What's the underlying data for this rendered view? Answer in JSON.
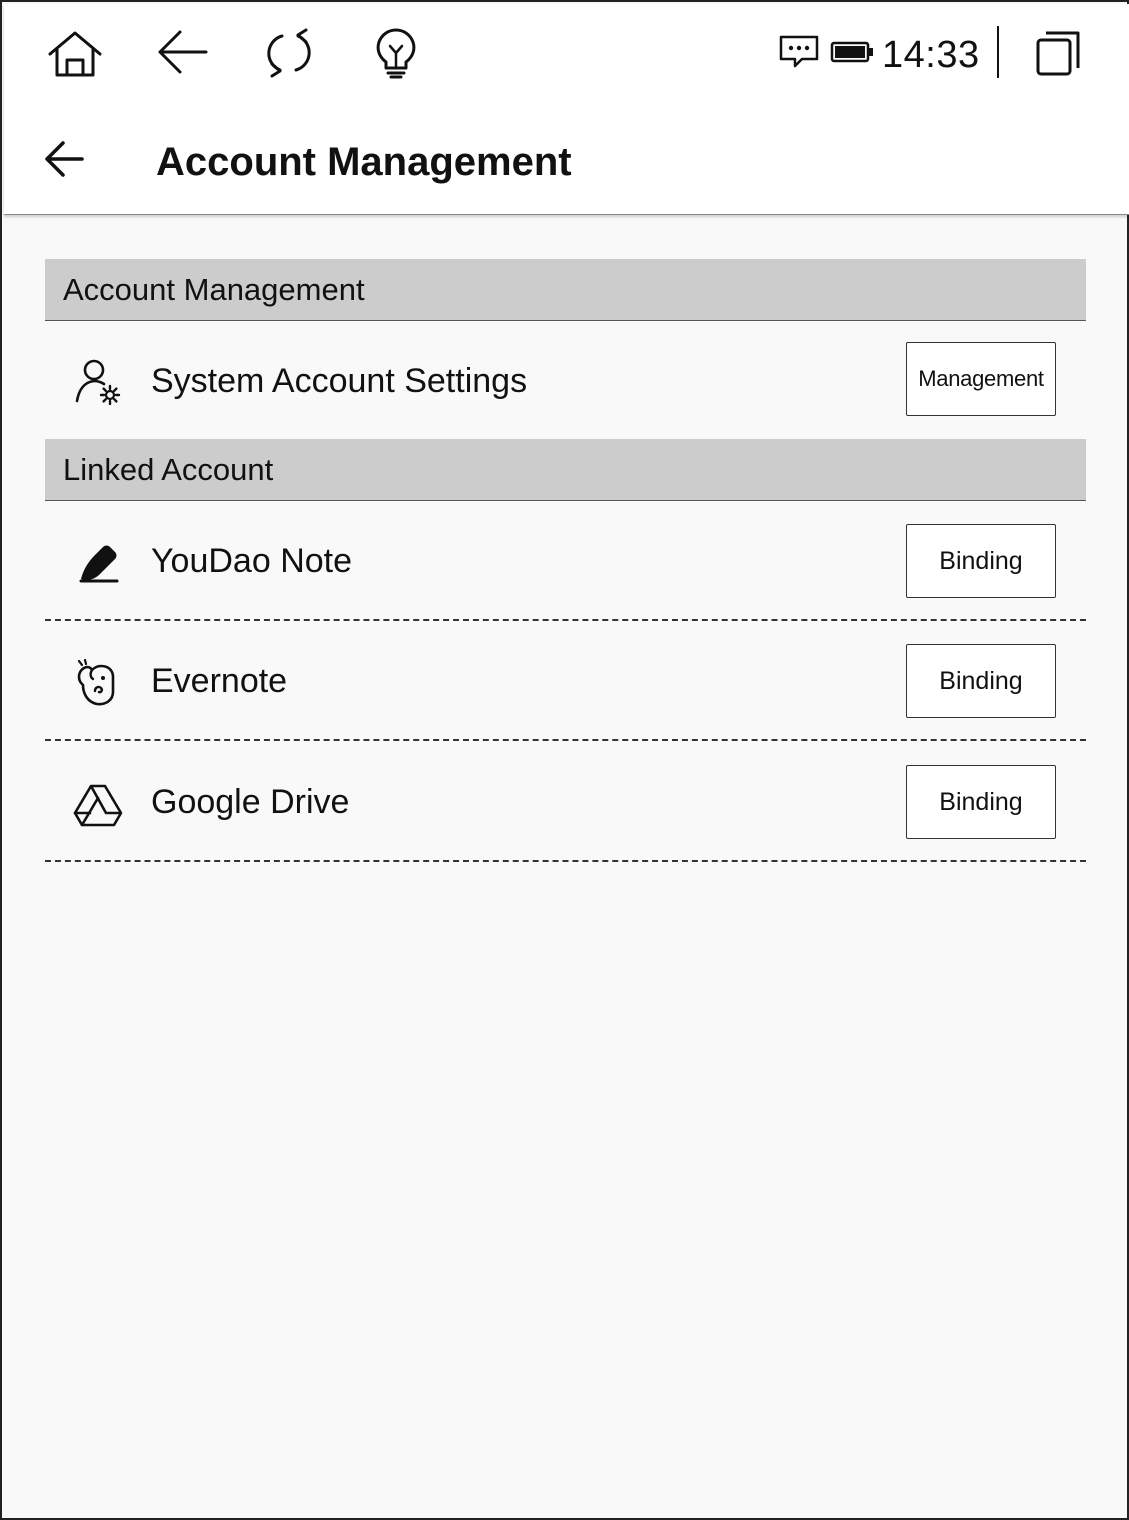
{
  "status_bar": {
    "icons": [
      "home-icon",
      "back-arrow-icon",
      "refresh-icon",
      "lightbulb-icon",
      "message-icon",
      "battery-icon",
      "window-switch-icon"
    ],
    "time": "14:33"
  },
  "header": {
    "back_icon": "back-arrow-icon",
    "title": "Account Management"
  },
  "sections": [
    {
      "title": "Account Management",
      "items": [
        {
          "icon": "user-settings-icon",
          "label": "System Account Settings",
          "button": "Management"
        }
      ]
    },
    {
      "title": "Linked Account",
      "items": [
        {
          "icon": "note-pen-icon",
          "label": "YouDao Note",
          "button": "Binding"
        },
        {
          "icon": "evernote-icon",
          "label": "Evernote",
          "button": "Binding"
        },
        {
          "icon": "google-drive-icon",
          "label": "Google Drive",
          "button": "Binding"
        }
      ]
    }
  ]
}
